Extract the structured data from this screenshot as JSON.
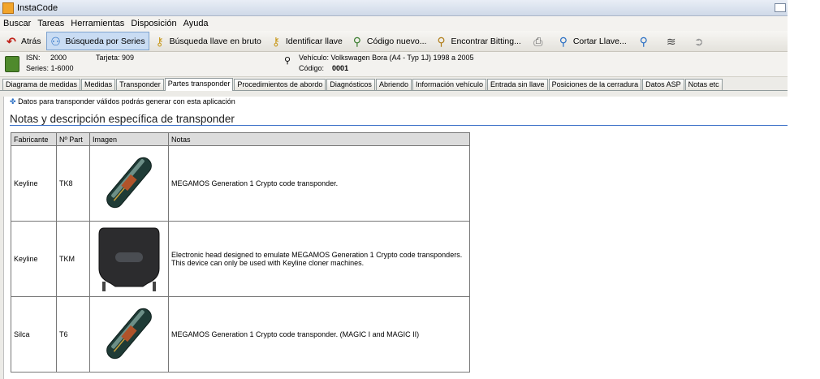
{
  "window": {
    "title": "InstaCode"
  },
  "menu": [
    "Buscar",
    "Tareas",
    "Herramientas",
    "Disposición",
    "Ayuda"
  ],
  "toolbar": {
    "back": "Atrás",
    "search_series": "Búsqueda por Series",
    "brute_force": "Búsqueda llave en bruto",
    "identify_key": "Identificar llave",
    "new_code": "Código nuevo...",
    "find_bitting": "Encontrar Bitting...",
    "cut_key": "Cortar Llave..."
  },
  "info": {
    "isn_label": "ISN:",
    "isn_value": "2000",
    "card_label": "Tarjeta:",
    "card_value": "909",
    "series_label": "Series:",
    "series_value": "1-6000",
    "vehicle_label": "Vehículo:",
    "vehicle_value": "Volkswagen Bora (A4 - Typ 1J) 1998 a 2005",
    "code_label": "Código:",
    "code_value": "0001"
  },
  "tabs": [
    "Diagrama de medidas",
    "Medidas",
    "Transponder",
    "Partes transponder",
    "Procedimientos de abordo",
    "Diagnósticos",
    "Abriendo",
    "Información vehículo",
    "Entrada sin llave",
    "Posiciones de la cerradura",
    "Datos ASP",
    "Notas etc"
  ],
  "active_tab": "Partes transponder",
  "content": {
    "note": "Datos para transponder válidos podrás generar con esta aplicación",
    "section_title": "Notas y descripción específica de transponder",
    "columns": [
      "Fabricante",
      "Nº Part",
      "Imagen",
      "Notas"
    ],
    "rows": [
      {
        "maker": "Keyline",
        "part": "TK8",
        "image": "glass-transponder",
        "notes": "MEGAMOS Generation 1 Crypto code transponder."
      },
      {
        "maker": "Keyline",
        "part": "TKM",
        "image": "key-head",
        "notes": "Electronic head designed to emulate MEGAMOS Generation 1 Crypto code transponders. This device can only be used with Keyline cloner machines."
      },
      {
        "maker": "Silca",
        "part": "T6",
        "image": "glass-transponder",
        "notes": "MEGAMOS Generation 1 Crypto code transponder. (MAGIC I and MAGIC II)"
      }
    ]
  }
}
